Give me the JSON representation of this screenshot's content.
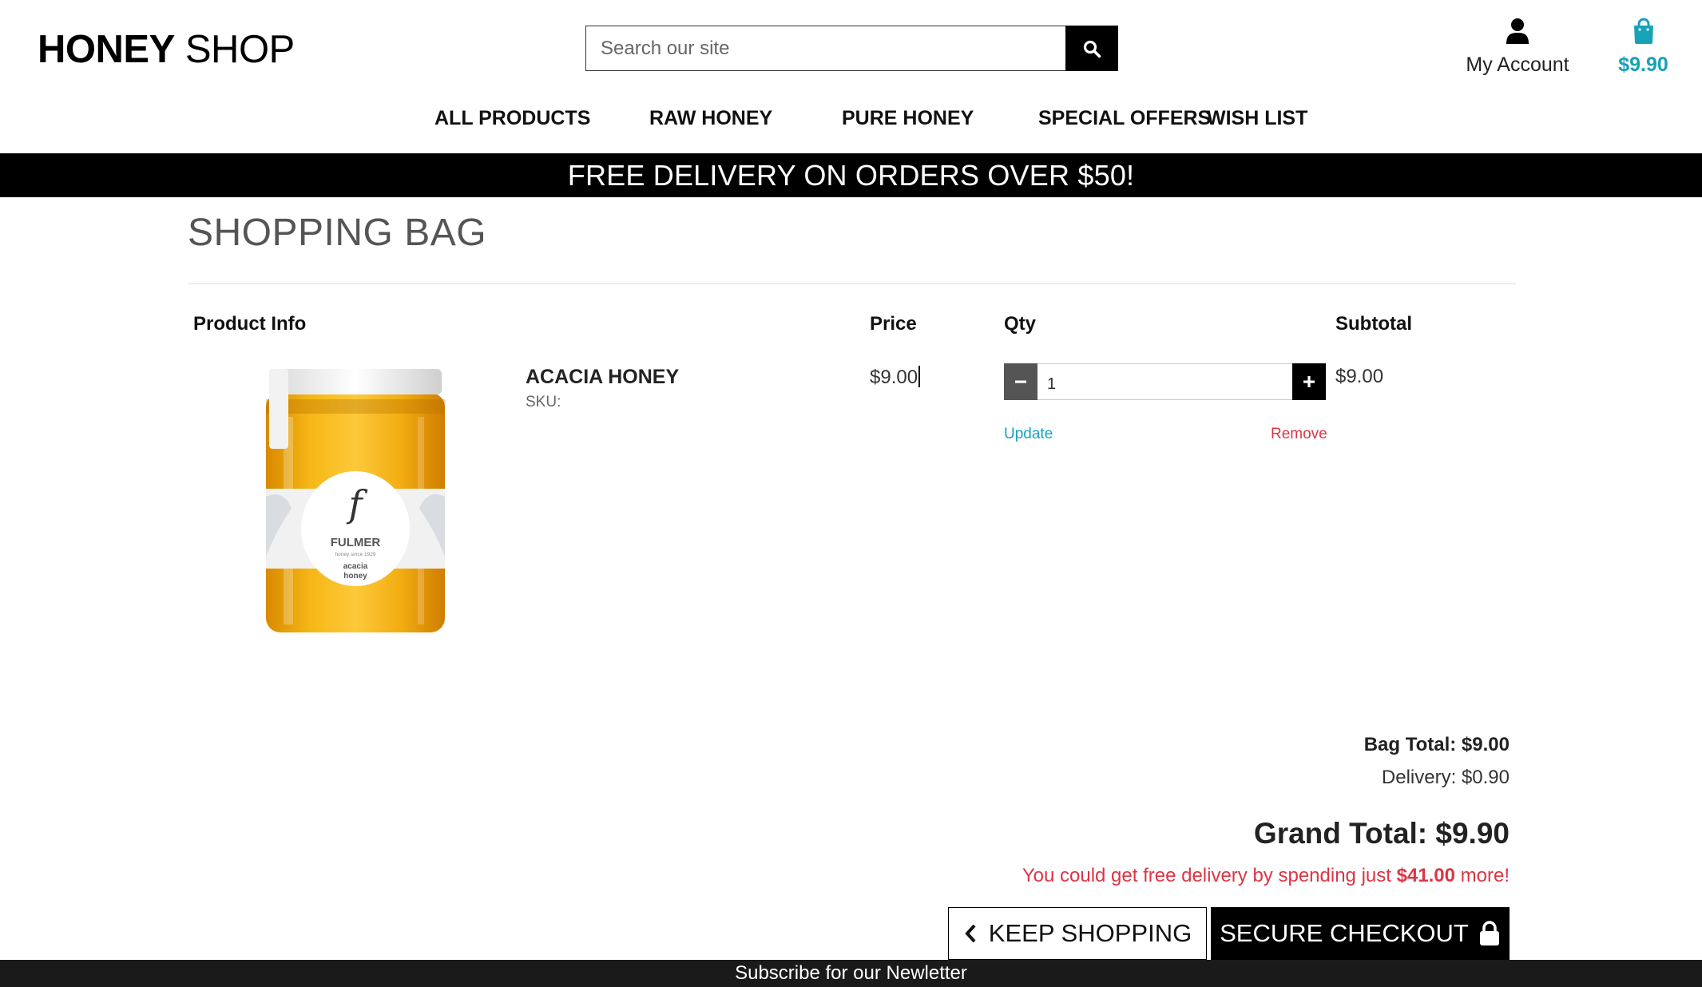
{
  "header": {
    "logo_bold": "HONEY",
    "logo_regular": " SHOP",
    "search": {
      "placeholder": "Search our site",
      "value": ""
    },
    "account_label": "My Account",
    "bag_amount": "$9.90",
    "accent_color": "#17a2b8"
  },
  "nav": {
    "items": [
      {
        "label": "ALL PRODUCTS"
      },
      {
        "label": "RAW HONEY"
      },
      {
        "label": "PURE HONEY"
      },
      {
        "label": "SPECIAL OFFERS"
      },
      {
        "label": "WISH LIST"
      }
    ]
  },
  "banner": {
    "text": "FREE DELIVERY ON ORDERS OVER $50!"
  },
  "page": {
    "title": "SHOPPING BAG"
  },
  "table": {
    "headers": {
      "product_info": "Product Info",
      "price": "Price",
      "qty": "Qty",
      "subtotal": "Subtotal"
    },
    "rows": [
      {
        "name": "ACACIA HONEY",
        "sku_label": "SKU:",
        "image_brand": "FULMER",
        "image_tagline": "honey since 1929",
        "image_variety_1": "acacia",
        "image_variety_2": "honey",
        "price": "$9.00",
        "qty": "1",
        "update_label": "Update",
        "remove_label": "Remove",
        "subtotal": "$9.00"
      }
    ]
  },
  "summary": {
    "bag_total": "Bag Total: $9.00",
    "delivery": "Delivery: $0.90",
    "grand_total": "Grand Total: $9.90",
    "free_delivery_prefix": "You could get free delivery by spending just ",
    "free_delivery_amount": "$41.00",
    "free_delivery_suffix": " more!",
    "alert_color": "#dc3545"
  },
  "actions": {
    "keep_shopping": "KEEP SHOPPING",
    "secure_checkout": "SECURE CHECKOUT"
  },
  "footer": {
    "text": "Subscribe for our Newletter"
  }
}
